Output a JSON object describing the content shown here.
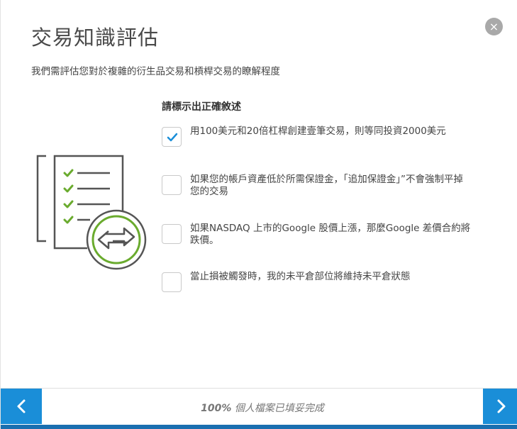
{
  "modal": {
    "title": "交易知識評估",
    "subtitle": "我們需評估您對於複雜的衍生品交易和槓桿交易的瞭解程度",
    "close_symbol": "×"
  },
  "quiz": {
    "question": "請標示出正確敘述",
    "options": [
      {
        "label": "用100美元和20倍杠桿創建壹筆交易，則等同投資2000美元",
        "checked": true
      },
      {
        "label": "如果您的帳戶資產低於所需保證金，「追加保證金」”不會強制平掉您的交易",
        "checked": false
      },
      {
        "label": "如果NASDAQ 上市的Google 股價上漲，那麼Google 差價合約將跌價。",
        "checked": false
      },
      {
        "label": "當止損被觸發時，我的未平倉部位將維持未平倉狀態",
        "checked": false
      }
    ]
  },
  "footer": {
    "progress_percent": "100%",
    "progress_label": " 個人檔案已填妥完成"
  },
  "colors": {
    "accent": "#1a8ed8",
    "check": "#1a8ed8",
    "green": "#6aab2e"
  },
  "icons": [
    "close-icon",
    "checklist-exchange-icon",
    "checkmark-icon",
    "chevron-left-icon",
    "chevron-right-icon"
  ]
}
